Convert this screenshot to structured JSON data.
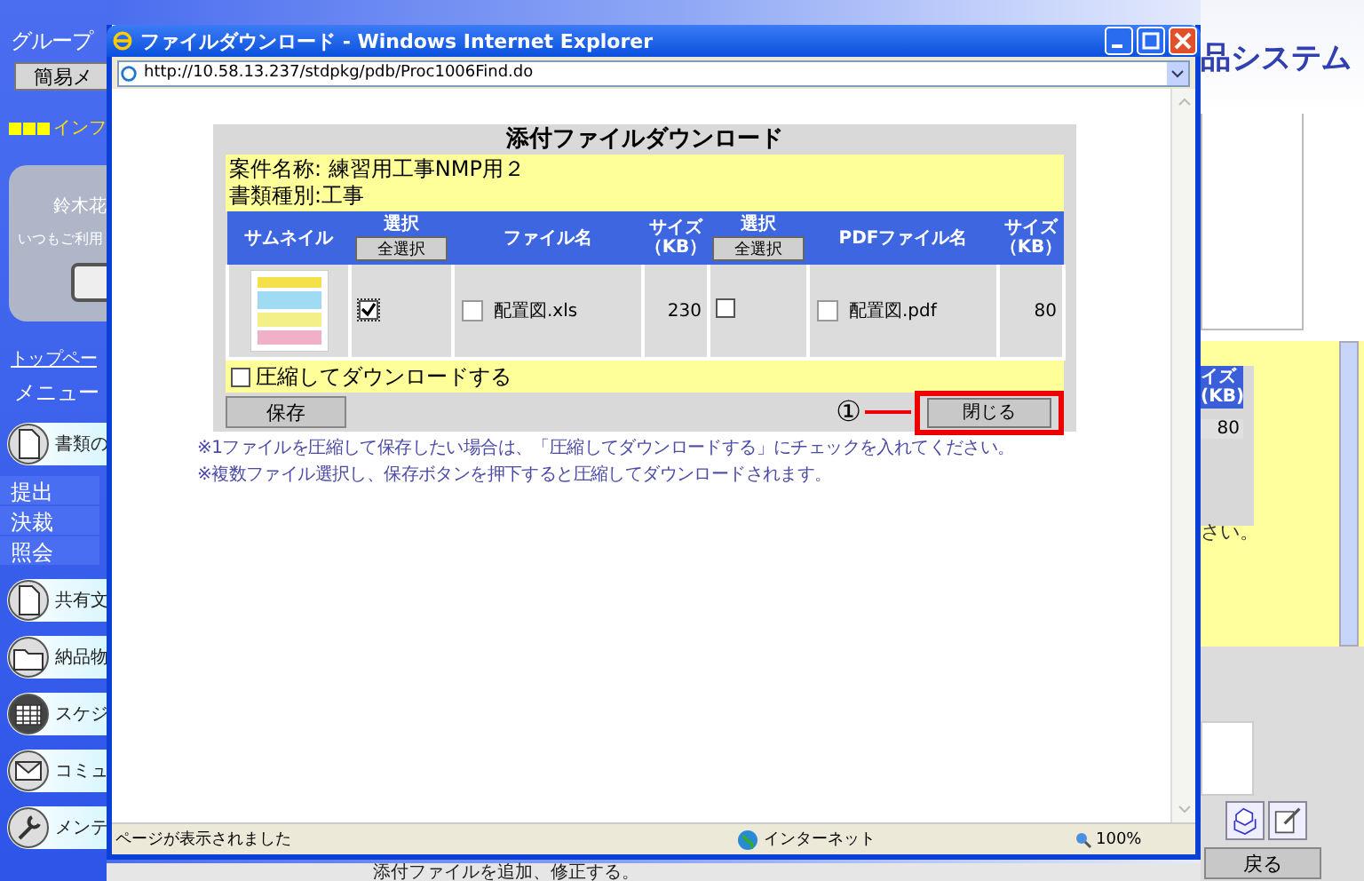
{
  "background_page": {
    "sidebar": {
      "group_label": "グループ",
      "menu_button": "簡易メ",
      "info_heading": "インフ",
      "user_card": {
        "name": "鈴木花",
        "greeting": "いつもご利用"
      },
      "top_link": "トップペー",
      "menu_label": "メニュー",
      "items": [
        {
          "kind": "document",
          "label": "書類の",
          "children": [
            {
              "label": "提出"
            },
            {
              "label": "決裁"
            },
            {
              "label": "照会"
            }
          ]
        },
        {
          "kind": "document",
          "label": "共有文"
        },
        {
          "kind": "folder",
          "label": "納品物"
        },
        {
          "kind": "calendar",
          "label": "スケジ"
        },
        {
          "kind": "mail",
          "label": "コミュ"
        },
        {
          "kind": "tools",
          "label": "メンテ"
        }
      ]
    },
    "header_title": "品システム",
    "table_partial": {
      "header": "イズ",
      "unit": "(KB)",
      "value": "80"
    },
    "note_partial": "さい。",
    "back_button": "戻る",
    "footer_text": "添付ファイルを追加、修正する。"
  },
  "popup": {
    "title": "ファイルダウンロード - Windows Internet Explorer",
    "address": "http://10.58.13.237/stdpkg/pdb/Proc1006Find.do",
    "heading": "添付ファイルダウンロード",
    "project_name": "案件名称: 練習用工事NMP用２",
    "document_type": "書類種別:工事",
    "columns": [
      {
        "kind": "text",
        "label": "サムネイル"
      },
      {
        "kind": "select",
        "label": "選択",
        "button": "全選択"
      },
      {
        "kind": "text",
        "label": "ファイル名"
      },
      {
        "kind": "size",
        "label": "サイズ",
        "unit": "（KB）"
      },
      {
        "kind": "select",
        "label": "選択",
        "button": "全選択"
      },
      {
        "kind": "text",
        "label": "PDFファイル名"
      },
      {
        "kind": "size",
        "label": "サイズ",
        "unit": "（KB）"
      }
    ],
    "rows": [
      {
        "file_checked": true,
        "file_name": "配置図.xls",
        "file_size": "230",
        "pdf_checked": false,
        "pdf_name": "配置図.pdf",
        "pdf_size": "80"
      }
    ],
    "compress": {
      "label": "圧縮してダウンロードする",
      "checked": false
    },
    "save_button": "保存",
    "callout": "①",
    "close_button": "閉じる",
    "notes": [
      "※1ファイルを圧縮して保存したい場合は、「圧縮してダウンロードする」にチェックを入れてください。",
      "※複数ファイル選択し、保存ボタンを押下すると圧縮してダウンロードされます。"
    ],
    "status_bar": {
      "message": "ページが表示されました",
      "zone": "インターネット",
      "zoom": "100%"
    }
  }
}
